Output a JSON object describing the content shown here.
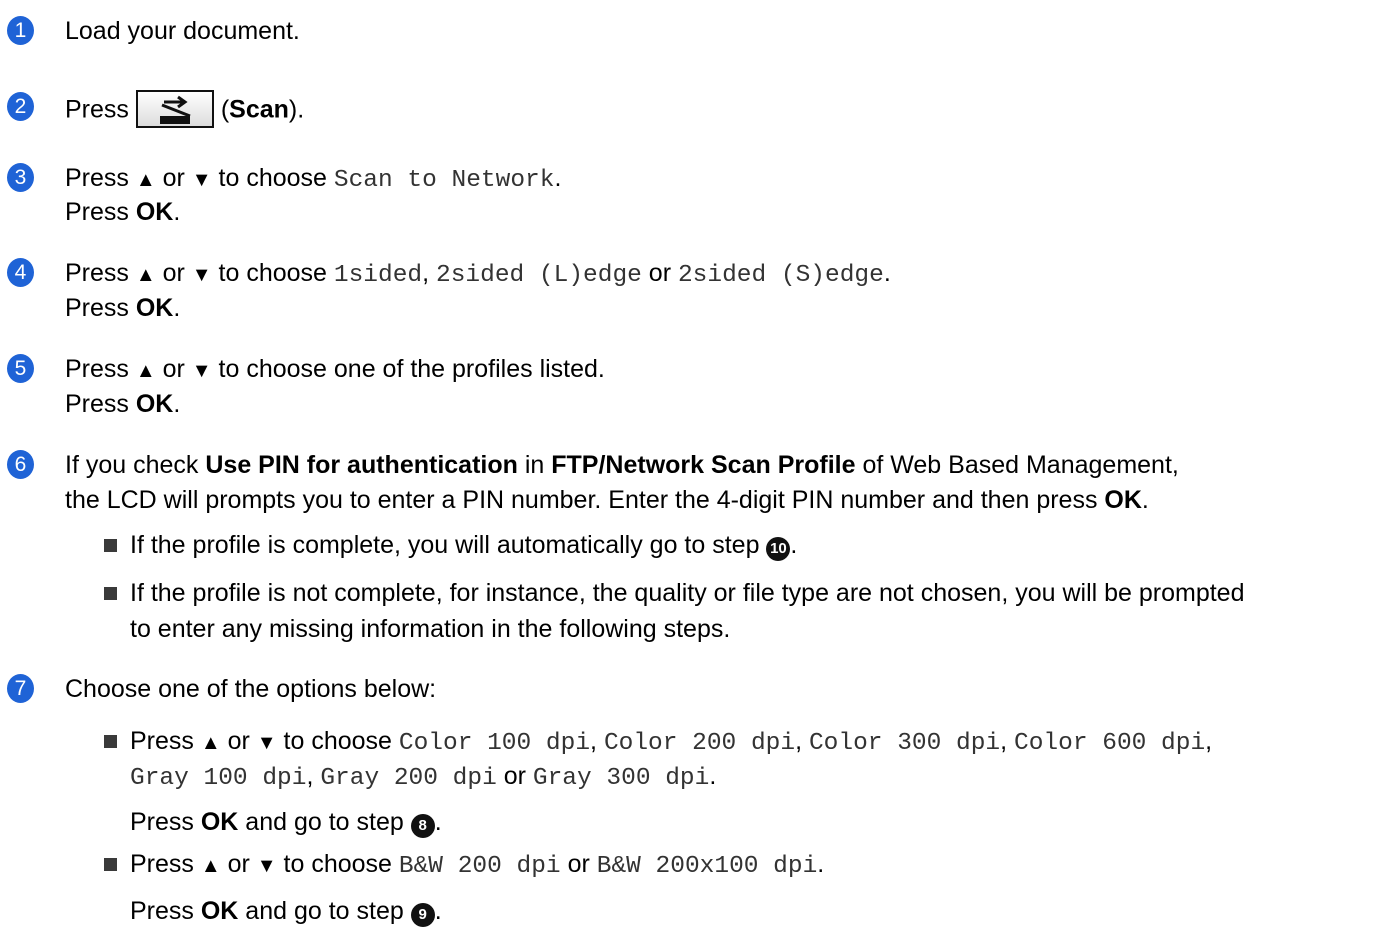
{
  "steps": [
    {
      "num": "1",
      "text": "Load your document."
    },
    {
      "num": "2",
      "press": "Press ",
      "label_open": "(",
      "label_bold": "Scan",
      "label_close": ")."
    },
    {
      "num": "3",
      "press": "Press ",
      "or": " or ",
      "to_choose": " to choose ",
      "option": "Scan to Network",
      "period": ".",
      "press2": "Press ",
      "ok": "OK",
      "period2": "."
    },
    {
      "num": "4",
      "press": "Press ",
      "or": " or ",
      "to_choose": " to choose ",
      "opt1": "1sided",
      "comma": ", ",
      "opt2": "2sided (L)edge",
      "or2": " or ",
      "opt3": "2sided (S)edge",
      "period": ".",
      "press2": "Press ",
      "ok": "OK",
      "period2": "."
    },
    {
      "num": "5",
      "press": "Press ",
      "or": " or ",
      "rest": " to choose one of the profiles listed.",
      "press2": "Press ",
      "ok": "OK",
      "period2": "."
    },
    {
      "num": "6",
      "l1_a": "If you check ",
      "l1_b": "Use PIN for authentication",
      "l1_c": " in ",
      "l1_d": "FTP/Network Scan Profile",
      "l1_e": " of Web Based Management,",
      "l2_a": "the LCD will prompts you to enter a PIN number. Enter the 4-digit PIN number and then press ",
      "l2_b": "OK",
      "l2_c": ".",
      "b1_a": "If the profile is complete, you will automatically go to step ",
      "b1_step": "10",
      "b1_c": ".",
      "b2_l1": "If the profile is not complete, for instance, the quality or file type are not chosen, you will be prompted",
      "b2_l2": "to enter any missing information in the following steps."
    },
    {
      "num": "7",
      "text": "Choose one of the options below:",
      "b1_press": "Press ",
      "b1_or": " or ",
      "b1_to": " to choose ",
      "b1_opts": [
        "Color 100 dpi",
        "Color 200 dpi",
        "Color 300 dpi",
        "Color 600 dpi",
        "Gray 100 dpi",
        "Gray 200 dpi",
        "Gray 300 dpi"
      ],
      "sep": ", ",
      "or_word": " or ",
      "period": ".",
      "b1_ok_a": "Press ",
      "b1_ok_b": "OK",
      "b1_ok_c": " and go to step ",
      "b1_step": "8",
      "b1_ok_d": ".",
      "b2_press": "Press ",
      "b2_or": " or ",
      "b2_to": " to choose ",
      "b2_opt1": "B&W 200 dpi",
      "b2_opt2": "B&W 200x100 dpi",
      "b2_ok_a": "Press ",
      "b2_ok_b": "OK",
      "b2_ok_c": " and go to step ",
      "b2_step": "9",
      "b2_ok_d": "."
    }
  ],
  "icons": {
    "up": "▲",
    "down": "▼",
    "scan": "scan-button-icon"
  },
  "colors": {
    "badge": "#1f63d6"
  }
}
